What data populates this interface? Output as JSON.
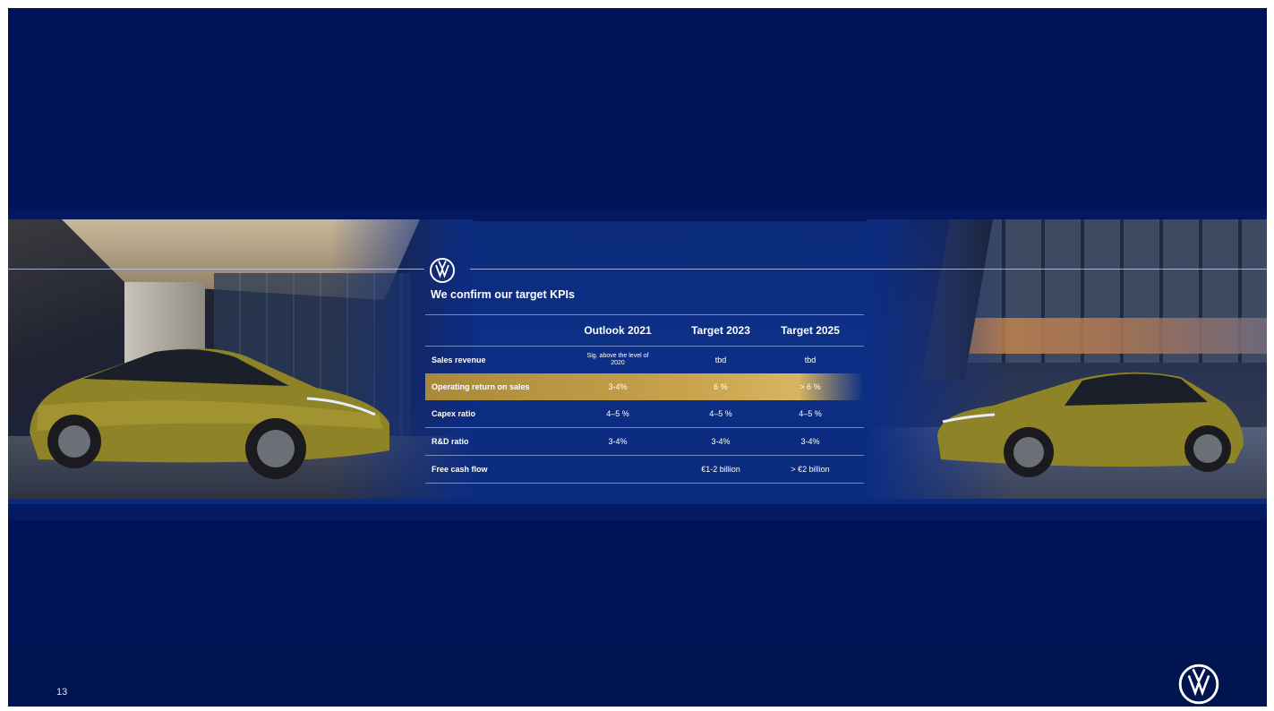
{
  "slide": {
    "title": "We confirm our target KPIs",
    "page_number": "13"
  },
  "table": {
    "headers": [
      "",
      "Outlook 2021",
      "Target 2023",
      "Target 2025"
    ],
    "rows": [
      {
        "label": "Sales revenue",
        "values": [
          "Sig. above the level of 2020",
          "tbd",
          "tbd"
        ],
        "highlight": false
      },
      {
        "label": "Operating return on sales",
        "values": [
          "3-4%",
          "6 %",
          "> 6 %"
        ],
        "highlight": true
      },
      {
        "label": "Capex ratio",
        "values": [
          "4–5 %",
          "4–5 %",
          "4–5 %"
        ],
        "highlight": false
      },
      {
        "label": "R&D ratio",
        "values": [
          "3-4%",
          "3-4%",
          "3-4%"
        ],
        "highlight": false
      },
      {
        "label": "Free cash flow",
        "values": [
          "",
          "€1-2 billion",
          "> €2 billion"
        ],
        "highlight": false
      }
    ]
  },
  "colors": {
    "background": "#001257",
    "highlight_row": "#c9a24d",
    "text": "#ffffff"
  }
}
